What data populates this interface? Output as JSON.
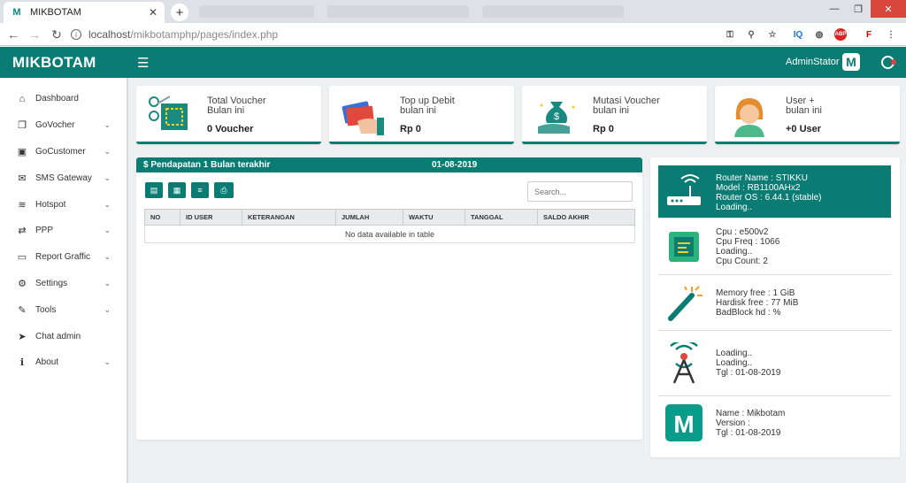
{
  "browser": {
    "tab_title": "MIKBOTAM",
    "tab_favicon": "M",
    "url_host": "localhost",
    "url_path": "/mikbotamphp/pages/index.php"
  },
  "header": {
    "brand": "MIKBOTAM",
    "user": "AdminStator",
    "logo_letter": "M"
  },
  "sidebar": {
    "items": [
      {
        "label": "Dashboard",
        "icon": "home-icon",
        "glyph": "⌂",
        "chevron": false
      },
      {
        "label": "GoVocher",
        "icon": "copy-icon",
        "glyph": "❐",
        "chevron": true
      },
      {
        "label": "GoCustomer",
        "icon": "id-card-icon",
        "glyph": "▣",
        "chevron": true
      },
      {
        "label": "SMS Gateway",
        "icon": "envelope-icon",
        "glyph": "✉",
        "chevron": true
      },
      {
        "label": "Hotspot",
        "icon": "wifi-icon",
        "glyph": "≋",
        "chevron": true
      },
      {
        "label": "PPP",
        "icon": "exchange-icon",
        "glyph": "⇄",
        "chevron": true
      },
      {
        "label": "Report Graffic",
        "icon": "monitor-icon",
        "glyph": "▭",
        "chevron": true
      },
      {
        "label": "Settings",
        "icon": "gears-icon",
        "glyph": "⚙",
        "chevron": true
      },
      {
        "label": "Tools",
        "icon": "wrench-icon",
        "glyph": "✎",
        "chevron": true
      },
      {
        "label": "Chat admin",
        "icon": "paper-plane-icon",
        "glyph": "➤",
        "chevron": false
      },
      {
        "label": "About",
        "icon": "info-icon",
        "glyph": "ℹ",
        "chevron": true
      }
    ]
  },
  "cards": [
    {
      "title": "Total Voucher",
      "subtitle": "Bulan ini",
      "value": "0 Voucher",
      "icon": "qr-scan-icon"
    },
    {
      "title": "Top up Debit",
      "subtitle": "bulan ini",
      "value": "Rp 0",
      "icon": "credit-card-hand-icon"
    },
    {
      "title": "Mutasi Voucher",
      "subtitle": "bulan ini",
      "value": "Rp 0",
      "icon": "money-bag-hand-icon"
    },
    {
      "title": "User +",
      "subtitle": "bulan ini",
      "value": "+0 User",
      "icon": "user-avatar-icon"
    }
  ],
  "income_panel": {
    "title": "$ Pendapatan 1 Bulan terakhir",
    "date": "01-08-2019",
    "search_placeholder": "Search...",
    "export_buttons": [
      "pdf-icon",
      "excel-icon",
      "database-icon",
      "print-icon"
    ],
    "columns": [
      "NO",
      "ID USER",
      "KETERANGAN",
      "JUMLAH",
      "WAKTU",
      "TANGGAL",
      "SALDO AKHIR"
    ],
    "empty_text": "No data available in table"
  },
  "router_panel": {
    "items": [
      {
        "icon": "router-icon",
        "lines": [
          "Router Name : STIKKU",
          "Model : RB1100AHx2",
          "Router OS : 6.44.1 (stable)",
          "Loading.."
        ]
      },
      {
        "icon": "cpu-icon",
        "lines": [
          "Cpu : e500v2",
          "Cpu Freq : 1066",
          "Loading..",
          "Cpu Count: 2"
        ]
      },
      {
        "icon": "magic-wand-icon",
        "lines": [
          "Memory free : 1 GiB",
          "Hardisk free : 77 MiB",
          "BadBlock hd : %"
        ]
      },
      {
        "icon": "antenna-icon",
        "lines": [
          "Loading..",
          "Loading..",
          "Tgl : 01-08-2019"
        ]
      },
      {
        "icon": "mikbotam-logo-icon",
        "lines": [
          "Name : Mikbotam",
          "Version :",
          "Tgl : 01-08-2019"
        ]
      }
    ]
  },
  "colors": {
    "primary": "#0a7c74",
    "background": "#eef0f2"
  }
}
